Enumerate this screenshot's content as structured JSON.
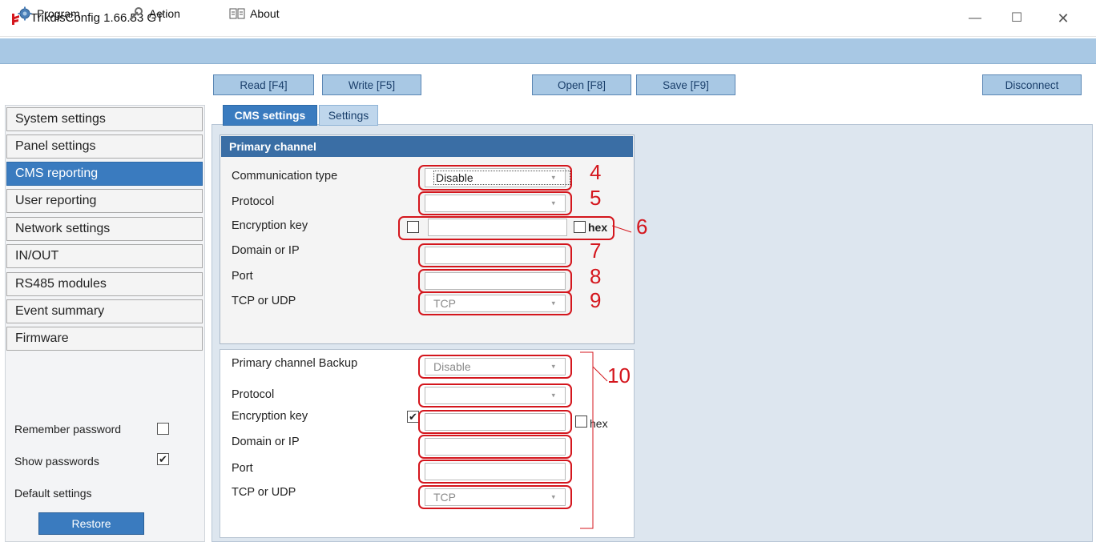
{
  "window": {
    "title": "TrikdisConfig 1.66.53   GT",
    "controls": [
      "—",
      "☐",
      "✕"
    ]
  },
  "menu": [
    {
      "label": "Program",
      "icon": "gear-icon"
    },
    {
      "label": "Action",
      "icon": "wrench-icon"
    },
    {
      "label": "About",
      "icon": "book-icon"
    }
  ],
  "toolbar": {
    "read": "Read [F4]",
    "write": "Write [F5]",
    "open": "Open [F8]",
    "save": "Save [F9]",
    "disconnect": "Disconnect"
  },
  "sidebar": {
    "items": [
      "System settings",
      "Panel settings",
      "CMS reporting",
      "User reporting",
      "Network settings",
      "IN/OUT",
      "RS485 modules",
      "Event summary",
      "Firmware"
    ],
    "active_index": 2,
    "remember_password": {
      "label": "Remember password",
      "checked": false
    },
    "show_passwords": {
      "label": "Show passwords",
      "checked": true
    },
    "default_settings": "Default settings",
    "restore": "Restore"
  },
  "tabs": {
    "cms": "CMS settings",
    "settings": "Settings"
  },
  "primary": {
    "header": "Primary channel",
    "communication_type": {
      "label": "Communication type",
      "value": "Disable"
    },
    "protocol": {
      "label": "Protocol",
      "value": ""
    },
    "encryption_key": {
      "label": "Encryption key",
      "value": "",
      "hex_label": "hex",
      "checked": false,
      "hex_checked": false
    },
    "domain": {
      "label": "Domain or IP",
      "value": ""
    },
    "port": {
      "label": "Port",
      "value": ""
    },
    "tcp_udp": {
      "label": "TCP or UDP",
      "value": "TCP"
    }
  },
  "backup": {
    "channel_backup": {
      "label": "Primary channel Backup",
      "value": "Disable"
    },
    "protocol": {
      "label": "Protocol",
      "value": ""
    },
    "encryption_key": {
      "label": "Encryption key",
      "value": "",
      "hex_label": "hex",
      "checked": true,
      "hex_checked": false
    },
    "domain": {
      "label": "Domain or IP",
      "value": ""
    },
    "port": {
      "label": "Port",
      "value": ""
    },
    "tcp_udp": {
      "label": "TCP or UDP",
      "value": "TCP"
    }
  },
  "annotations": [
    "4",
    "5",
    "6",
    "7",
    "8",
    "9",
    "10"
  ],
  "colors": {
    "menubar": "#a8c8e4",
    "accent": "#3a7bbf",
    "group_header": "#3a6ea5",
    "annotation_red": "#d4161d"
  }
}
